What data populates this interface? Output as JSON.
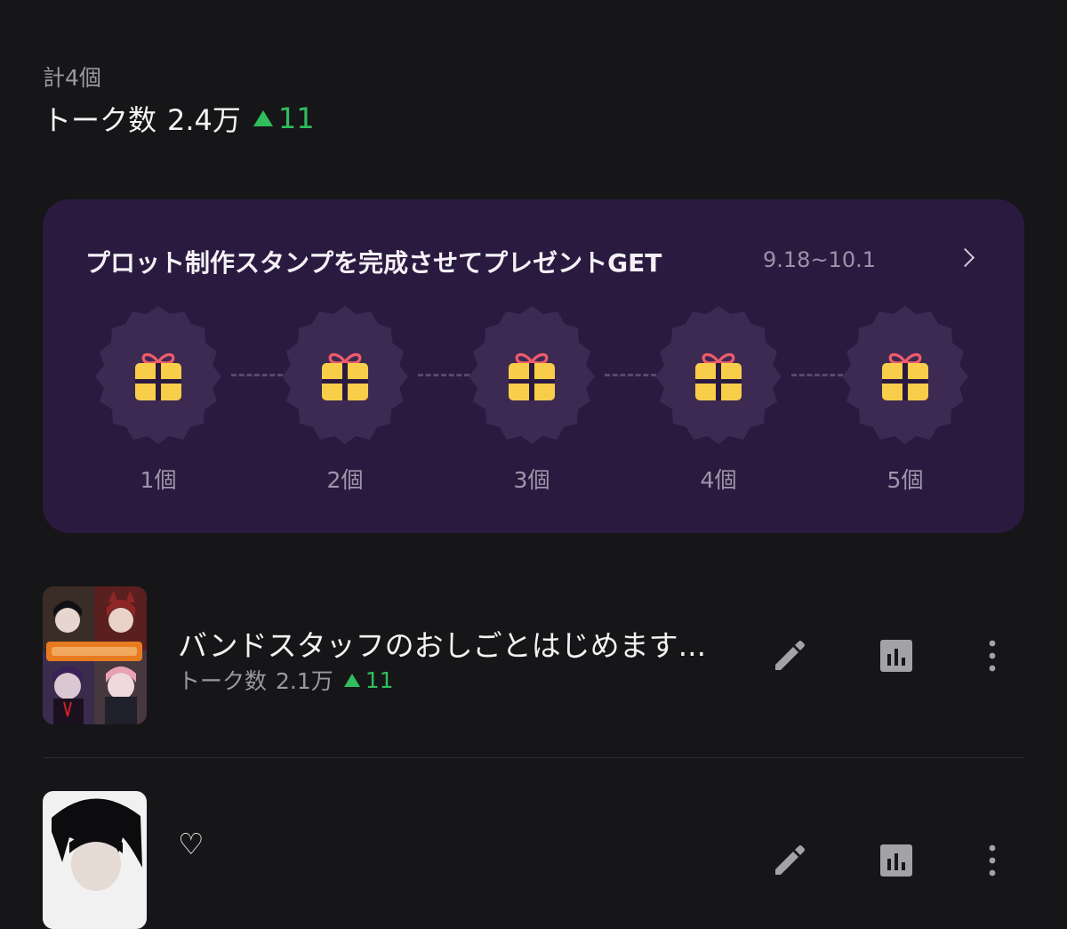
{
  "summary": {
    "count_label": "計4個",
    "talk_label": "トーク数",
    "talk_value": "2.4万",
    "talk_delta": "11"
  },
  "stamp_campaign": {
    "title": "プロット制作スタンプを完成させてプレゼントGET",
    "period": "9.18~10.1",
    "stamps": [
      {
        "label": "1個"
      },
      {
        "label": "2個"
      },
      {
        "label": "3個"
      },
      {
        "label": "4個"
      },
      {
        "label": "5個"
      }
    ],
    "icon": "gift-icon"
  },
  "stories": [
    {
      "title": "バンドスタッフのおしごとはじめます...",
      "stat_label": "トーク数",
      "stat_value": "2.1万",
      "stat_delta": "11"
    },
    {
      "title": "♡"
    }
  ],
  "colors": {
    "background": "#161618",
    "card": "#2b1a3f",
    "badge": "#3d2a52",
    "gift": "#f7cd4a",
    "ribbon": "#ef5b6b",
    "delta_green": "#2fbd5e"
  }
}
